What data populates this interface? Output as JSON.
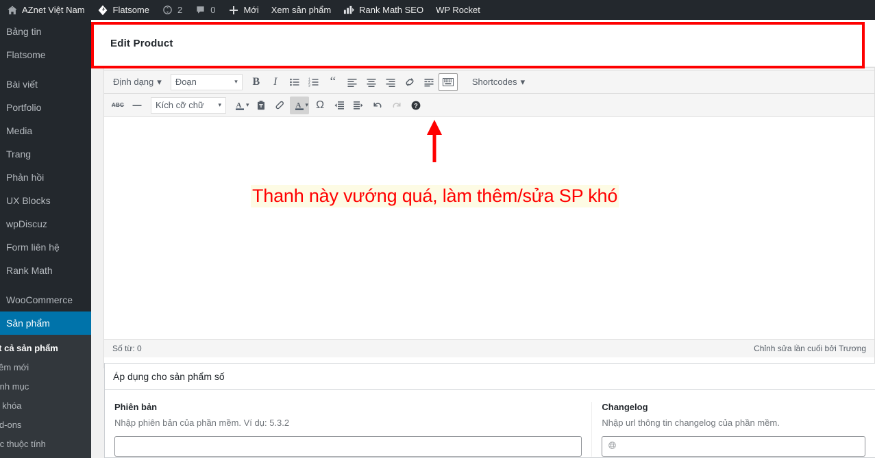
{
  "adminbar": {
    "items": [
      {
        "icon": "wordpress-home-icon",
        "label": "AZnet Việt Nam"
      },
      {
        "icon": "flatsome-icon",
        "label": "Flatsome"
      },
      {
        "icon": "update-icon",
        "label": "2"
      },
      {
        "icon": "comment-icon",
        "label": "0"
      },
      {
        "icon": "plus-icon",
        "label": "Mới"
      },
      {
        "icon": "",
        "label": "Xem sản phẩm"
      },
      {
        "icon": "chart-icon",
        "label": "Rank Math SEO"
      },
      {
        "icon": "",
        "label": "WP Rocket"
      }
    ]
  },
  "sidebar": {
    "items": [
      {
        "label": "Bảng tin",
        "state": "normal"
      },
      {
        "label": "Flatsome",
        "state": "normal"
      },
      {
        "label": "Bài viết",
        "state": "separated"
      },
      {
        "label": "Portfolio",
        "state": "normal"
      },
      {
        "label": "Media",
        "state": "normal"
      },
      {
        "label": "Trang",
        "state": "normal"
      },
      {
        "label": "Phản hồi",
        "state": "normal"
      },
      {
        "label": "UX Blocks",
        "state": "normal"
      },
      {
        "label": "wpDiscuz",
        "state": "normal"
      },
      {
        "label": "Form liên hệ",
        "state": "normal"
      },
      {
        "label": "Rank Math",
        "state": "normal"
      },
      {
        "label": "WooCommerce",
        "state": "separated"
      },
      {
        "label": "Sản phẩm",
        "state": "current"
      }
    ],
    "submenu": [
      {
        "label": "Tất cả sản phẩm",
        "active": true
      },
      {
        "label": "Thêm mới",
        "active": false
      },
      {
        "label": "Danh mục",
        "active": false
      },
      {
        "label": "Từ khóa",
        "active": false
      },
      {
        "label": "Add-ons",
        "active": false
      },
      {
        "label": "Các thuộc tính",
        "active": false
      }
    ]
  },
  "page": {
    "title": "Edit Product"
  },
  "editor": {
    "toolbar_row1": {
      "format_label": "Định dạng",
      "paragraph_select": "Đoạn",
      "shortcodes_label": "Shortcodes",
      "buttons": [
        {
          "name": "bold-icon",
          "glyph": "B"
        },
        {
          "name": "italic-icon",
          "glyph": "I"
        },
        {
          "name": "bulleted-list-icon",
          "glyph": ""
        },
        {
          "name": "numbered-list-icon",
          "glyph": ""
        },
        {
          "name": "blockquote-icon",
          "glyph": ""
        },
        {
          "name": "align-left-icon",
          "glyph": ""
        },
        {
          "name": "align-center-icon",
          "glyph": ""
        },
        {
          "name": "align-right-icon",
          "glyph": ""
        },
        {
          "name": "insert-link-icon",
          "glyph": ""
        },
        {
          "name": "read-more-icon",
          "glyph": ""
        },
        {
          "name": "keyboard-shortcuts-icon",
          "glyph": ""
        }
      ]
    },
    "toolbar_row2": {
      "fontsize_select": "Kích cỡ chữ",
      "buttons": [
        {
          "name": "strikethrough-icon",
          "glyph": "ABC"
        },
        {
          "name": "horizontal-rule-icon",
          "glyph": ""
        },
        {
          "name": "text-color-icon",
          "glyph": "A"
        },
        {
          "name": "paste-as-text-icon",
          "glyph": ""
        },
        {
          "name": "clear-formatting-icon",
          "glyph": ""
        },
        {
          "name": "highlight-color-icon",
          "glyph": "A"
        },
        {
          "name": "special-character-icon",
          "glyph": "Ω"
        },
        {
          "name": "outdent-icon",
          "glyph": ""
        },
        {
          "name": "indent-icon",
          "glyph": ""
        },
        {
          "name": "undo-icon",
          "glyph": ""
        },
        {
          "name": "redo-icon",
          "glyph": ""
        },
        {
          "name": "help-icon",
          "glyph": "?"
        }
      ]
    },
    "statusbar": {
      "word_count": "Số từ: 0",
      "last_edited": "Chỉnh sửa lần cuối bởi Trương"
    }
  },
  "metabox": {
    "title": "Áp dụng cho sản phẩm số",
    "fields": [
      {
        "label": "Phiên bản",
        "description": "Nhập phiên bản của phần mềm. Ví dụ: 5.3.2",
        "value": "",
        "icon": ""
      },
      {
        "label": "Changelog",
        "description": "Nhập url thông tin changelog của phần mềm.",
        "value": "",
        "icon": "globe-icon"
      }
    ]
  },
  "annotations": {
    "callout_text": "Thanh này vướng quá, làm thêm/sửa SP khó",
    "highlight_color": "#fe0000",
    "text_background": "#fdfbe4"
  }
}
